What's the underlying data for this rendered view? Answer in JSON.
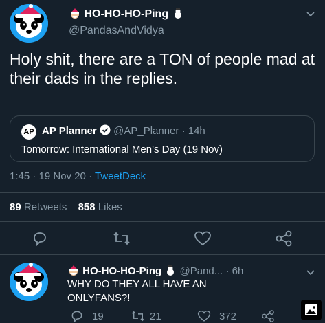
{
  "main_tweet": {
    "name": "HO-HO-HO-Ping",
    "handle": "@PandasAndVidya",
    "text": "Holy shit, there are a TON of people mad at their dads in the replies.",
    "quote": {
      "logo_text": "AP",
      "name": "AP Planner",
      "handle": "@AP_Planner",
      "separator": "·",
      "time": "14h",
      "text": "Tomorrow: International Men's Day (19 Nov)"
    },
    "timestamp": "1:45 · 19 Nov 20 ·",
    "source": "TweetDeck",
    "retweets_count": "89",
    "retweets_label": "Retweets",
    "likes_count": "858",
    "likes_label": "Likes"
  },
  "reply": {
    "name": "HO-HO-HO-Ping",
    "handle": "@Pand...",
    "time": "· 6h",
    "text_line1": "WHY DO THEY ALL HAVE AN",
    "text_line2": "ONLYFANS?!",
    "reply_count": "19",
    "retweet_count": "21",
    "like_count": "372"
  },
  "colors": {
    "background": "#15202b",
    "muted": "#8899a6",
    "link": "#1da1f2",
    "divider": "#38444d"
  },
  "icons": [
    "santa-emoji-icon",
    "snowman-emoji-icon",
    "chevron-down-icon",
    "verified-badge-icon",
    "reply-icon",
    "retweet-icon",
    "like-icon",
    "share-icon",
    "image-icon"
  ]
}
